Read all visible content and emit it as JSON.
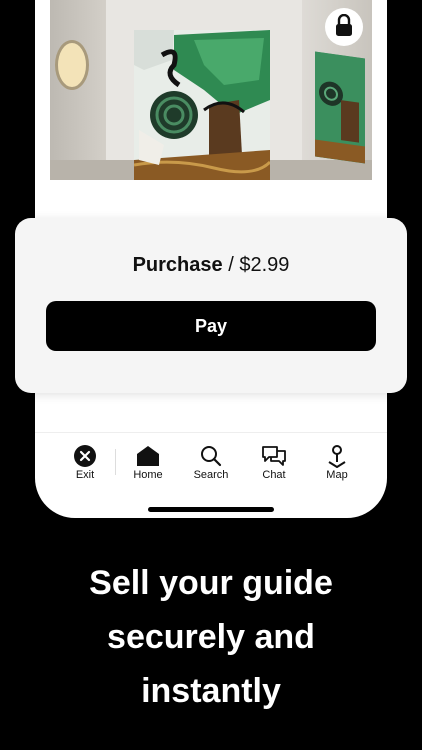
{
  "purchase": {
    "label": "Purchase",
    "separator": " / ",
    "price": "$2.99",
    "pay_button_label": "Pay"
  },
  "tab_bar": {
    "items": [
      {
        "label": "Exit",
        "icon": "close-circle-icon"
      },
      {
        "label": "Home",
        "icon": "home-icon"
      },
      {
        "label": "Search",
        "icon": "search-icon"
      },
      {
        "label": "Chat",
        "icon": "chat-icon"
      },
      {
        "label": "Map",
        "icon": "map-pin-icon"
      }
    ]
  },
  "headline": {
    "line1": "Sell your guide",
    "line2": "securely and",
    "line3": "instantly"
  },
  "colors": {
    "background": "#000000",
    "card": "#f5f5f5",
    "pay_button": "#000000",
    "text": "#111111"
  }
}
